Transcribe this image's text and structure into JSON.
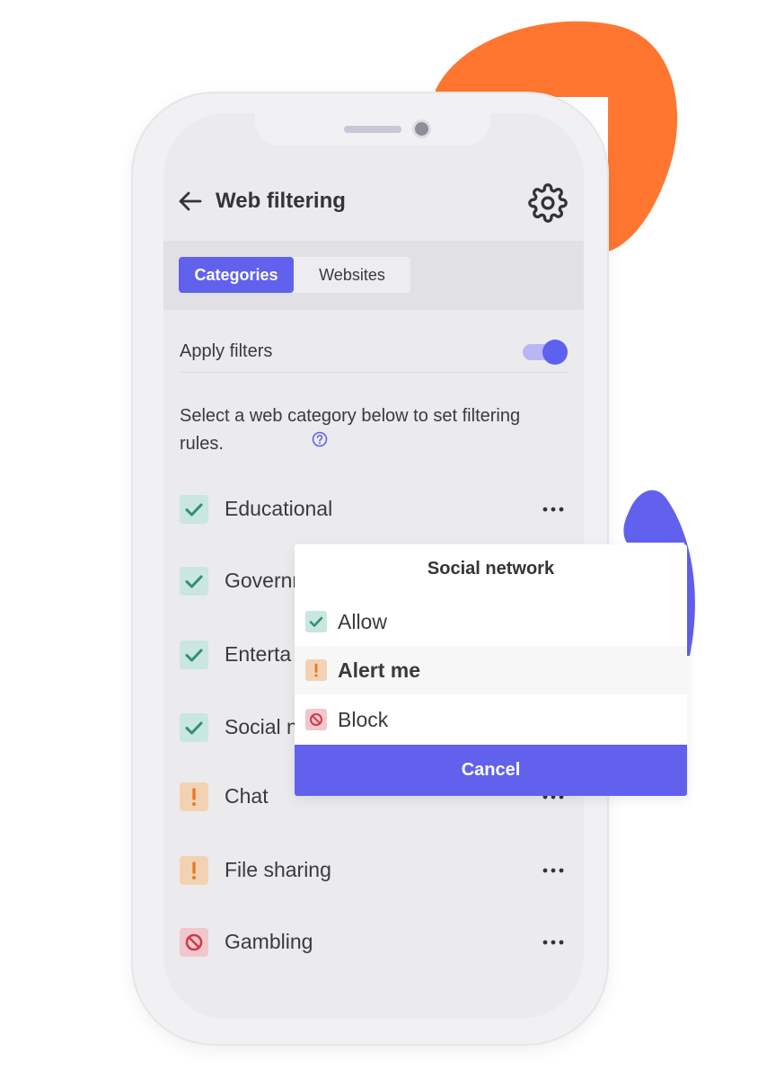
{
  "app": {
    "title": "Web filtering"
  },
  "colors": {
    "accent": "#6161ee",
    "decor_orange": "#ff7630",
    "decor_blue": "#6161ee",
    "allow": "#2f8f7a",
    "alert": "#e8792b",
    "block": "#d2394b"
  },
  "tabs": [
    {
      "label": "Categories",
      "active": true
    },
    {
      "label": "Websites",
      "active": false
    }
  ],
  "apply_filters": {
    "label": "Apply filters",
    "enabled": true
  },
  "description": "Select a web category below to set filtering rules.",
  "categories": [
    {
      "label": "Educational",
      "status": "allow",
      "icon": "check-icon"
    },
    {
      "label": "Governm",
      "status": "allow",
      "icon": "check-icon"
    },
    {
      "label": "Enterta",
      "status": "allow",
      "icon": "check-icon"
    },
    {
      "label": "Social n",
      "status": "allow",
      "icon": "check-icon"
    },
    {
      "label": "Chat",
      "status": "alert",
      "icon": "exclamation-icon"
    },
    {
      "label": "File sharing",
      "status": "alert",
      "icon": "exclamation-icon"
    },
    {
      "label": "Gambling",
      "status": "block",
      "icon": "block-icon"
    }
  ],
  "popup": {
    "title": "Social network",
    "options": [
      {
        "label": "Allow",
        "icon": "check-icon"
      },
      {
        "label": "Alert me",
        "icon": "exclamation-icon",
        "highlighted": true
      },
      {
        "label": "Block",
        "icon": "block-icon"
      }
    ],
    "cancel_label": "Cancel"
  }
}
